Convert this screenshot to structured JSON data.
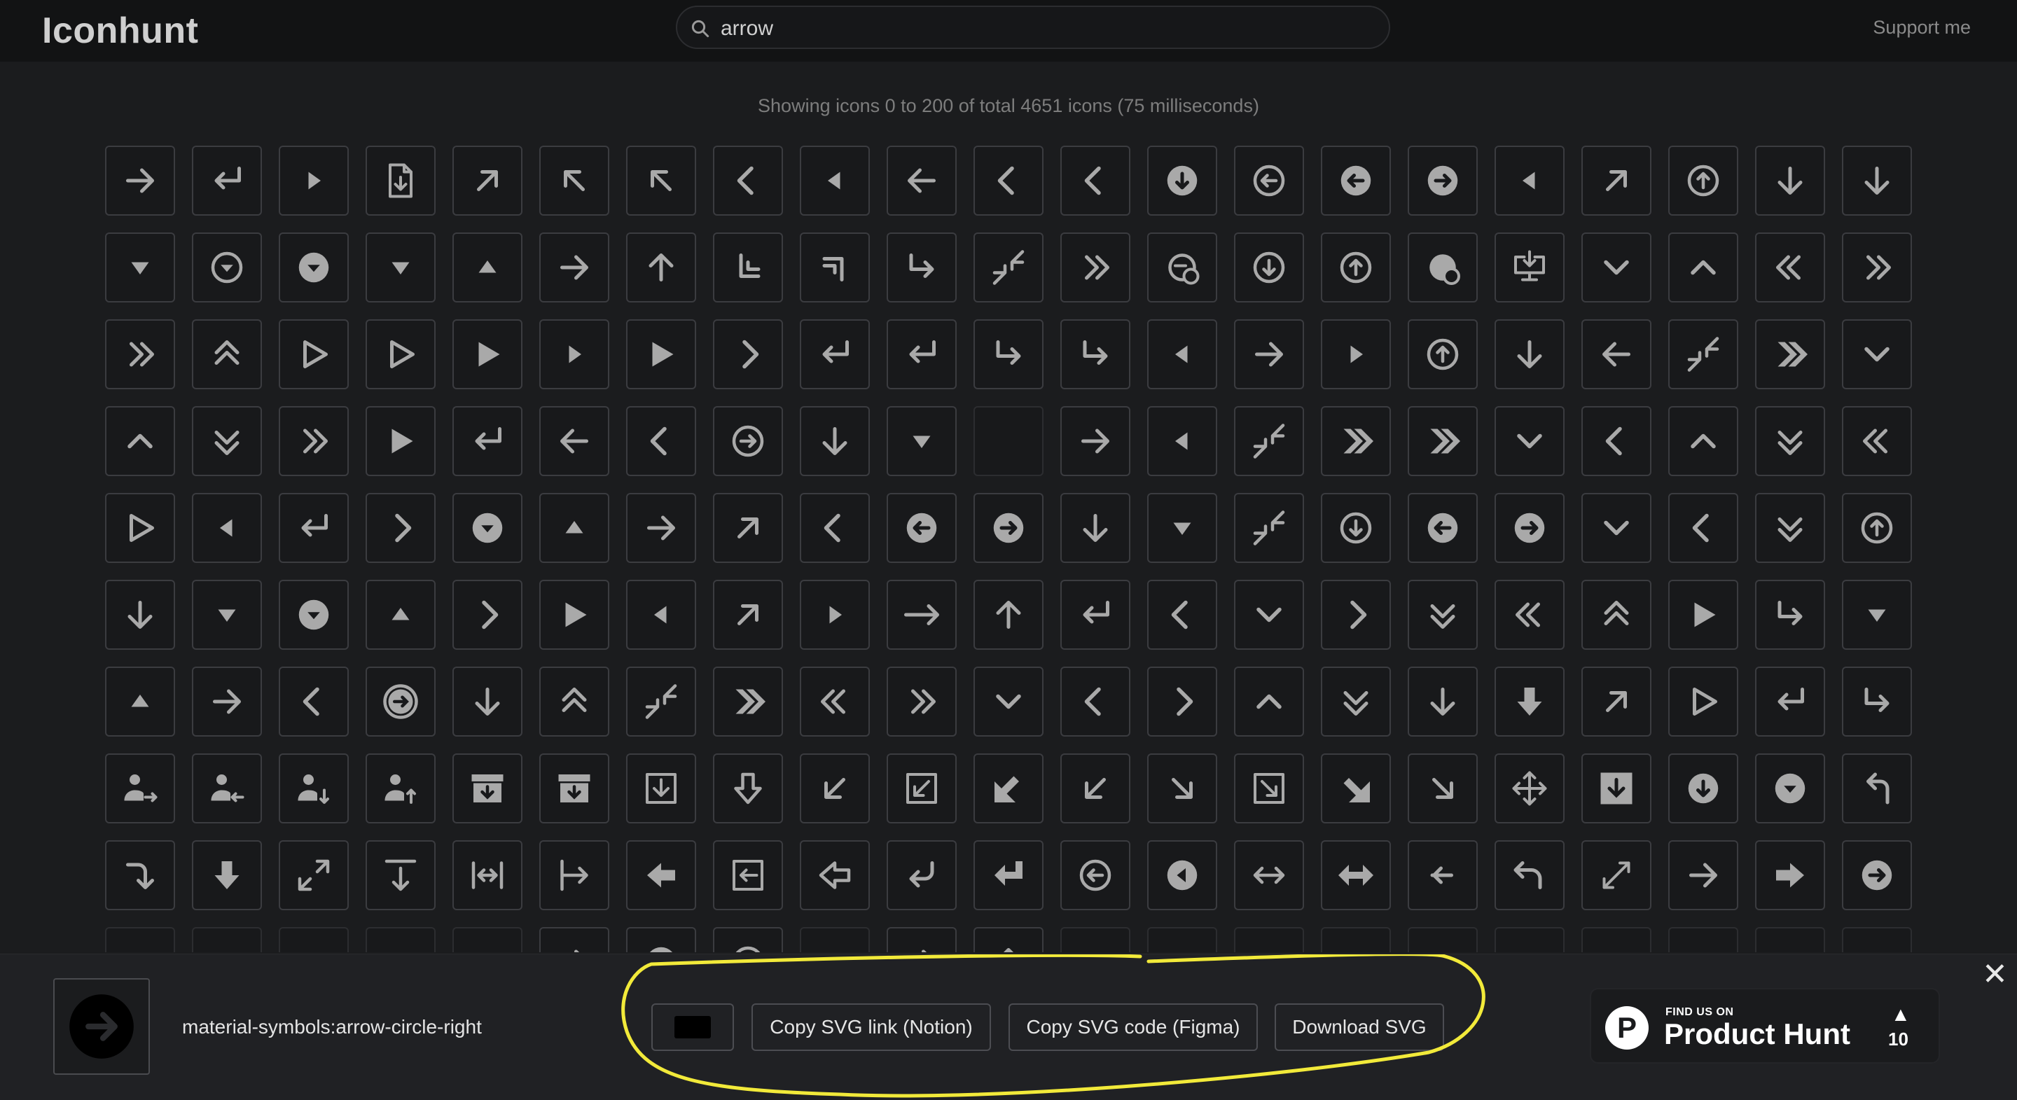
{
  "app": {
    "title": "Iconhunt"
  },
  "search": {
    "value": "arrow"
  },
  "header": {
    "support_label": "Support me"
  },
  "stats": {
    "text": "Showing icons 0 to 200 of total 4651 icons (75 milliseconds)"
  },
  "colors": {
    "icon": "#a9a9a9",
    "highlight": "#f2ea3a"
  },
  "grid": {
    "columns": 21,
    "icons": [
      "arrow-right",
      "return-left",
      "caret-right",
      "file-download",
      "arrow-up-right",
      "arrow-up-left",
      "arrow-up-left",
      "chevron-left",
      "caret-left",
      "arrow-left",
      "chevron-left",
      "chevron-left",
      "circle-arrow-down-filled",
      "circle-arrow-left",
      "circle-arrow-left-filled",
      "circle-arrow-right-filled",
      "caret-left",
      "arrow-up-right",
      "circle-arrow-up",
      "arrow-down",
      "arrow-down",
      "caret-down",
      "circle-caret-down",
      "circle-caret-down-filled",
      "caret-down",
      "caret-up",
      "arrow-right",
      "arrow-up",
      "corner-down-left",
      "corner-up-right",
      "subdirectory-right",
      "collapse-arrows",
      "double-chevron-right",
      "circle-minus-refresh",
      "circle-arrow-down",
      "circle-arrow-up",
      "circle-refresh-filled",
      "monitor-download",
      "chevron-down",
      "chevron-up",
      "double-chevron-left",
      "double-chevron-right",
      "double-chevron-right",
      "double-chevron-up",
      "play-outline",
      "play-outline",
      "play",
      "caret-right",
      "play",
      "chevron-right",
      "return-left",
      "return-left",
      "subdirectory-right",
      "subdirectory-right",
      "caret-left",
      "arrow-right",
      "caret-right",
      "circle-arrow-up",
      "arrow-down",
      "arrow-left",
      "collapse-arrows",
      "double-chevron-right-bold",
      "chevron-down",
      "chevron-up",
      "double-chevron-down",
      "double-chevron-right",
      "play",
      "return-left",
      "arrow-left",
      "chevron-left",
      "circle-arrow-right",
      "arrow-down",
      "caret-down",
      "empty",
      "arrow-right",
      "caret-left",
      "collapse-arrows",
      "double-chevron-right-bold",
      "double-chevron-right-bold",
      "chevron-down",
      "chevron-left",
      "chevron-up",
      "double-chevron-down",
      "double-chevron-left",
      "play-outline",
      "caret-left",
      "return-left",
      "chevron-right",
      "circle-caret-down-filled",
      "caret-up",
      "arrow-right",
      "arrow-up-right",
      "chevron-left",
      "circle-arrow-left-filled",
      "circle-arrow-right-filled",
      "arrow-down",
      "caret-down",
      "collapse-arrows",
      "circle-arrow-down",
      "circle-arrow-left-filled",
      "circle-arrow-right-filled",
      "chevron-down",
      "chevron-left",
      "double-chevron-down",
      "circle-arrow-up",
      "arrow-down",
      "caret-down",
      "circle-caret-down-filled",
      "caret-up",
      "chevron-right",
      "play",
      "caret-left",
      "arrow-up-right",
      "caret-right",
      "arrow-right-long",
      "arrow-up",
      "return-left",
      "chevron-left",
      "chevron-down",
      "chevron-right",
      "double-chevron-down",
      "double-chevron-left",
      "double-chevron-up",
      "play",
      "subdirectory-right",
      "caret-down",
      "caret-up",
      "arrow-right",
      "chevron-left",
      "circle-arrow-right-gray",
      "arrow-down",
      "double-chevron-up",
      "collapse-arrows",
      "double-chevron-right-bold",
      "double-chevron-left",
      "double-chevron-right",
      "chevron-down",
      "chevron-left",
      "chevron-right",
      "chevron-up",
      "double-chevron-down",
      "arrow-down",
      "arrow-down-bold",
      "arrow-up-right",
      "play-outline",
      "return-left",
      "subdirectory-right",
      "person-arrow-right",
      "person-arrow-left",
      "person-arrow-down",
      "person-arrow-up",
      "archive-download",
      "archive-download",
      "box-arrow-down",
      "arrow-down-outline",
      "arrow-down-left",
      "box-arrow-down-left",
      "arrow-down-left-bold",
      "arrow-down-left",
      "arrow-down-right",
      "box-arrow-down-right",
      "arrow-down-right-bold",
      "arrow-down-right",
      "move-arrows",
      "box-arrow-down-filled",
      "circle-arrow-down-filled",
      "circle-caret-down-filled",
      "return-up-left",
      "turn-down-right",
      "arrow-down-bold",
      "expand-diagonal",
      "vertical-align-bottom",
      "width-arrows",
      "arrow-right-to-bar",
      "arrow-left-bold",
      "box-arrow-left",
      "arrow-left-outline",
      "return-left-curved",
      "return-left-bold",
      "circle-arrow-left",
      "circle-caret-left-filled",
      "arrows-left-right",
      "arrows-left-right-bold",
      "arrow-left-small",
      "undo-arrow",
      "arrow-diagonal-double",
      "arrow-right",
      "arrow-right-bold",
      "circle-arrow-right-filled",
      "empty",
      "empty",
      "empty",
      "empty",
      "empty",
      "arrow-right",
      "circle-filled",
      "circle-arrow-right",
      "empty",
      "arrow-right",
      "arrow-up",
      "empty",
      "empty",
      "empty",
      "empty",
      "empty",
      "empty",
      "empty",
      "empty",
      "empty",
      "empty"
    ]
  },
  "selected": {
    "icon": "circle-arrow-right-filled",
    "name": "material-symbols:arrow-circle-right",
    "color": "#000000"
  },
  "actions": {
    "copy_link_label": "Copy SVG link (Notion)",
    "copy_code_label": "Copy SVG code (Figma)",
    "download_label": "Download SVG"
  },
  "producthunt": {
    "small_text": "FIND US ON",
    "big_text": "Product Hunt",
    "logo_letter": "P",
    "upvote_symbol": "▲",
    "count": "10"
  },
  "close_symbol": "✕"
}
